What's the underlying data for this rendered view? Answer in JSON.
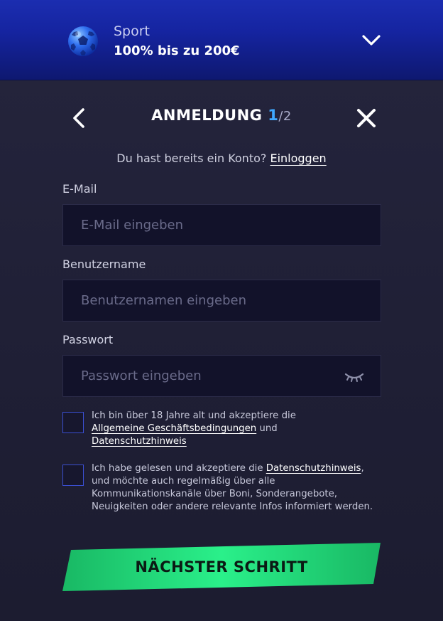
{
  "bonus": {
    "category": "Sport",
    "offer": "100% bis zu 200€"
  },
  "header": {
    "title": "ANMELDUNG",
    "step_current": "1",
    "step_total": "/2"
  },
  "login": {
    "prompt": "Du hast bereits ein Konto?",
    "link": "Einloggen"
  },
  "fields": {
    "email": {
      "label": "E-Mail",
      "placeholder": "E-Mail eingeben",
      "value": ""
    },
    "username": {
      "label": "Benutzername",
      "placeholder": "Benutzernamen eingeben",
      "value": ""
    },
    "password": {
      "label": "Passwort",
      "placeholder": "Passwort eingeben",
      "value": ""
    }
  },
  "consents": {
    "age": {
      "text_1": "Ich bin über 18 Jahre alt und akzeptiere die",
      "link_terms": "Allgemeine Geschäftsbedingungen",
      "text_2": "und",
      "link_privacy": "Datenschutzhinweis",
      "checked": false
    },
    "marketing": {
      "text_1": "Ich habe gelesen und akzeptiere die",
      "link_privacy": "Datenschutzhinweis",
      "text_2": ", und möchte auch regelmäßig über alle Kommunikationskanäle über Boni, Sonderangebote, Neuigkeiten oder andere relevante Infos informiert werden.",
      "checked": false
    }
  },
  "actions": {
    "next_label": "NÄCHSTER SCHRITT"
  },
  "icons": {
    "bonus": "soccer-ball-icon",
    "expand": "chevron-down-icon",
    "back": "chevron-left-icon",
    "close": "close-icon",
    "toggle_password": "eye-closed-icon"
  },
  "colors": {
    "accent_blue": "#3fa9ff",
    "button_green": "#20e07a",
    "checkbox_border": "#3a4fd0"
  }
}
